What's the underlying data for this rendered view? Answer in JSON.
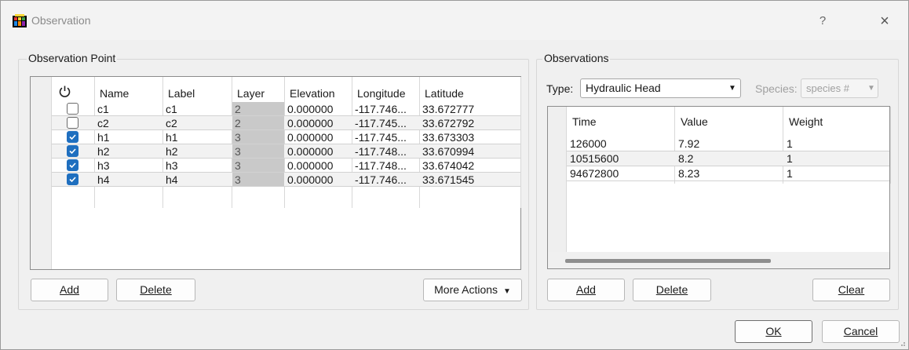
{
  "window": {
    "title": "Observation",
    "help_symbol": "?",
    "close_symbol": "×",
    "icon": "app-grid-icon"
  },
  "observation_point": {
    "group_title": "Observation Point",
    "columns": [
      "",
      "Name",
      "Label",
      "Layer",
      "Elevation",
      "Longitude",
      "Latitude"
    ],
    "power_icon": "power-icon",
    "rows": [
      {
        "checked": false,
        "name": "c1",
        "label": "c1",
        "layer": "2",
        "elevation": "0.000000",
        "longitude": "-117.746...",
        "latitude": "33.672777"
      },
      {
        "checked": false,
        "name": "c2",
        "label": "c2",
        "layer": "2",
        "elevation": "0.000000",
        "longitude": "-117.745...",
        "latitude": "33.672792"
      },
      {
        "checked": true,
        "name": "h1",
        "label": "h1",
        "layer": "3",
        "elevation": "0.000000",
        "longitude": "-117.745...",
        "latitude": "33.673303"
      },
      {
        "checked": true,
        "name": "h2",
        "label": "h2",
        "layer": "3",
        "elevation": "0.000000",
        "longitude": "-117.748...",
        "latitude": "33.670994"
      },
      {
        "checked": true,
        "name": "h3",
        "label": "h3",
        "layer": "3",
        "elevation": "0.000000",
        "longitude": "-117.748...",
        "latitude": "33.674042"
      },
      {
        "checked": true,
        "name": "h4",
        "label": "h4",
        "layer": "3",
        "elevation": "0.000000",
        "longitude": "-117.746...",
        "latitude": "33.671545"
      }
    ],
    "add_label": "Add",
    "delete_label": "Delete",
    "more_actions_label": "More Actions"
  },
  "observations": {
    "group_title": "Observations",
    "type_label": "Type:",
    "type_value": "Hydraulic Head",
    "species_label": "Species:",
    "species_value": "species #",
    "columns": [
      "Time",
      "Value",
      "Weight"
    ],
    "rows": [
      {
        "time": "126000",
        "value": "7.92",
        "weight": "1"
      },
      {
        "time": "10515600",
        "value": "8.2",
        "weight": "1"
      },
      {
        "time": "94672800",
        "value": "8.23",
        "weight": "1"
      }
    ],
    "add_label": "Add",
    "delete_label": "Delete",
    "clear_label": "Clear"
  },
  "dialog": {
    "ok_label": "OK",
    "cancel_label": "Cancel"
  },
  "colors": {
    "checkbox_checked": "#1f6fbf",
    "layer_cell_bg": "#c9c9c9"
  }
}
